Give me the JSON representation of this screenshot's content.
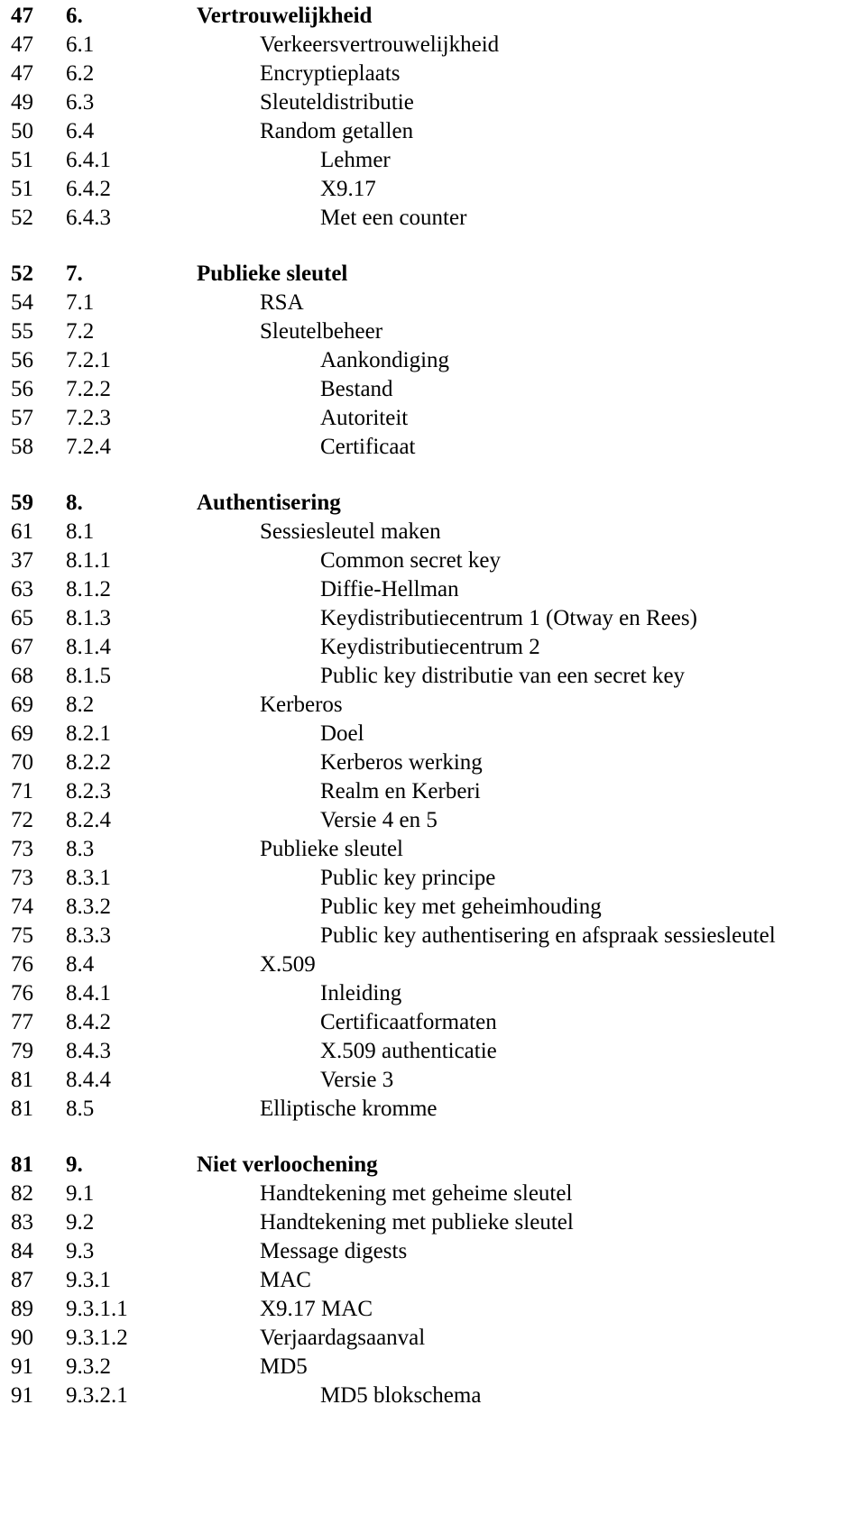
{
  "document": {
    "type": "table-of-contents",
    "language": "nl",
    "columns": [
      "page",
      "section",
      "title"
    ]
  },
  "entries": [
    {
      "page": "47",
      "section": "6.",
      "title": "Vertrouwelijkheid",
      "level": 1
    },
    {
      "page": "47",
      "section": "6.1",
      "title": "Verkeersvertrouwelijkheid",
      "level": 2
    },
    {
      "page": "47",
      "section": "6.2",
      "title": "Encryptieplaats",
      "level": 2
    },
    {
      "page": "49",
      "section": "6.3",
      "title": "Sleuteldistributie",
      "level": 2
    },
    {
      "page": "50",
      "section": "6.4",
      "title": "Random getallen",
      "level": 2
    },
    {
      "page": "51",
      "section": "6.4.1",
      "title": "Lehmer",
      "level": 3
    },
    {
      "page": "51",
      "section": "6.4.2",
      "title": "X9.17",
      "level": 3
    },
    {
      "page": "52",
      "section": "6.4.3",
      "title": "Met een counter",
      "level": 3
    },
    {
      "page": "",
      "section": "",
      "title": "",
      "level": 0
    },
    {
      "page": "52",
      "section": "7.",
      "title": "Publieke sleutel",
      "level": 1
    },
    {
      "page": "54",
      "section": "7.1",
      "title": "RSA",
      "level": 2
    },
    {
      "page": "55",
      "section": "7.2",
      "title": "Sleutelbeheer",
      "level": 2
    },
    {
      "page": "56",
      "section": "7.2.1",
      "title": "Aankondiging",
      "level": 3
    },
    {
      "page": "56",
      "section": "7.2.2",
      "title": "Bestand",
      "level": 3
    },
    {
      "page": "57",
      "section": "7.2.3",
      "title": "Autoriteit",
      "level": 3
    },
    {
      "page": "58",
      "section": "7.2.4",
      "title": "Certificaat",
      "level": 3
    },
    {
      "page": "",
      "section": "",
      "title": "",
      "level": 0
    },
    {
      "page": "59",
      "section": "8.",
      "title": "Authentisering",
      "level": 1
    },
    {
      "page": "61",
      "section": "8.1",
      "title": "Sessiesleutel maken",
      "level": 2
    },
    {
      "page": "37",
      "section": "8.1.1",
      "title": "Common secret key",
      "level": 3
    },
    {
      "page": "63",
      "section": "8.1.2",
      "title": "Diffie-Hellman",
      "level": 3
    },
    {
      "page": "65",
      "section": "8.1.3",
      "title": "Keydistributiecentrum 1 (Otway en Rees)",
      "level": 3
    },
    {
      "page": "67",
      "section": "8.1.4",
      "title": "Keydistributiecentrum 2",
      "level": 3
    },
    {
      "page": "68",
      "section": "8.1.5",
      "title": "Public key distributie van een secret key",
      "level": 3
    },
    {
      "page": "69",
      "section": "8.2",
      "title": "Kerberos",
      "level": 2
    },
    {
      "page": "69",
      "section": "8.2.1",
      "title": "Doel",
      "level": 3
    },
    {
      "page": "70",
      "section": "8.2.2",
      "title": "Kerberos werking",
      "level": 3
    },
    {
      "page": "71",
      "section": "8.2.3",
      "title": "Realm en Kerberi",
      "level": 3
    },
    {
      "page": "72",
      "section": "8.2.4",
      "title": "Versie 4 en 5",
      "level": 3
    },
    {
      "page": "73",
      "section": "8.3",
      "title": "Publieke sleutel",
      "level": 2
    },
    {
      "page": "73",
      "section": "8.3.1",
      "title": "Public key principe",
      "level": 3
    },
    {
      "page": "74",
      "section": "8.3.2",
      "title": "Public key met geheimhouding",
      "level": 3
    },
    {
      "page": "75",
      "section": "8.3.3",
      "title": "Public key authentisering en afspraak sessiesleutel",
      "level": 3
    },
    {
      "page": "76",
      "section": "8.4",
      "title": "X.509",
      "level": 2
    },
    {
      "page": "76",
      "section": "8.4.1",
      "title": "Inleiding",
      "level": 3
    },
    {
      "page": "77",
      "section": "8.4.2",
      "title": "Certificaatformaten",
      "level": 3
    },
    {
      "page": "79",
      "section": "8.4.3",
      "title": "X.509 authenticatie",
      "level": 3
    },
    {
      "page": "81",
      "section": "8.4.4",
      "title": "Versie 3",
      "level": 3
    },
    {
      "page": "81",
      "section": "8.5",
      "title": "Elliptische kromme",
      "level": 2
    },
    {
      "page": "",
      "section": "",
      "title": "",
      "level": 0
    },
    {
      "page": "81",
      "section": "9.",
      "title": "Niet verloochening",
      "level": 1
    },
    {
      "page": "82",
      "section": "9.1",
      "title": "Handtekening met geheime sleutel",
      "level": 2
    },
    {
      "page": "83",
      "section": "9.2",
      "title": "Handtekening met publieke sleutel",
      "level": 2
    },
    {
      "page": "84",
      "section": "9.3",
      "title": "Message digests",
      "level": 2
    },
    {
      "page": "87",
      "section": "9.3.1",
      "title": "MAC",
      "level": 2
    },
    {
      "page": "89",
      "section": "9.3.1.1",
      "title": "X9.17 MAC",
      "level": 2
    },
    {
      "page": "90",
      "section": "9.3.1.2",
      "title": "Verjaardagsaanval",
      "level": 2
    },
    {
      "page": "91",
      "section": "9.3.2",
      "title": "MD5",
      "level": 2
    },
    {
      "page": "91",
      "section": "9.3.2.1",
      "title": "MD5 blokschema",
      "level": 3
    }
  ]
}
